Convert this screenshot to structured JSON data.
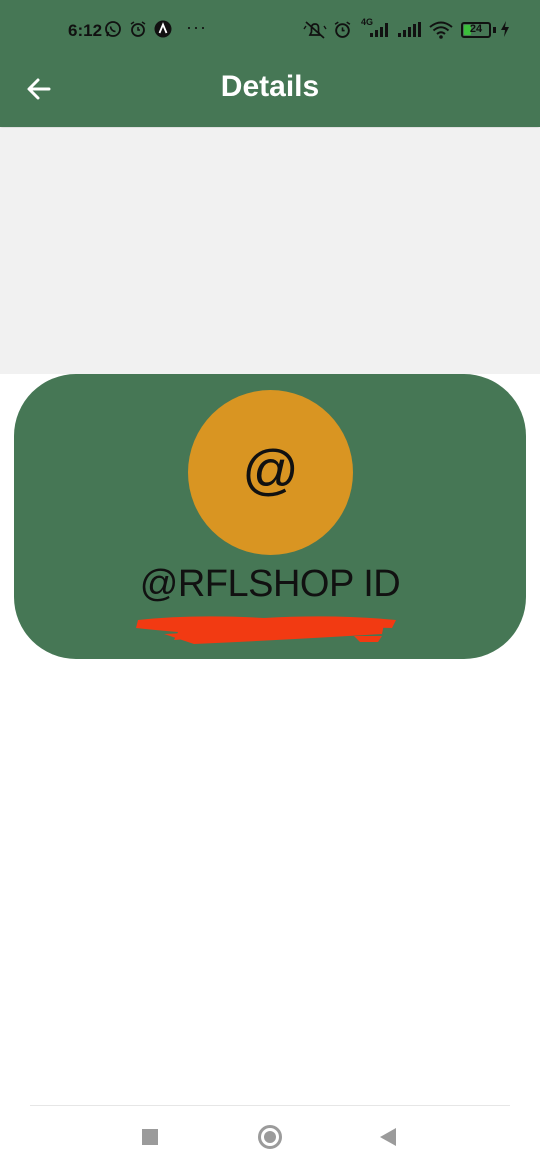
{
  "status_bar": {
    "time": "6:12",
    "icons": [
      "whatsapp-icon",
      "alarm-icon",
      "app-notification-icon",
      "more-notifications-icon",
      "mute-icon",
      "alarm-icon",
      "signal-4g-icon",
      "signal-icon",
      "wifi-icon",
      "battery-icon",
      "charging-icon"
    ],
    "more": "···",
    "network": "4G",
    "battery_level": "24"
  },
  "app_bar": {
    "title": "Details",
    "back_icon": "arrow-left-icon"
  },
  "card": {
    "avatar_symbol": "@",
    "title": "@RFLSHOP ID"
  },
  "nav_bar": {
    "buttons": [
      "recents-square-icon",
      "home-circle-icon",
      "back-triangle-icon"
    ]
  },
  "colors": {
    "primary": "#467755",
    "accent": "#d99522",
    "background_gray": "#f1f1f1",
    "redaction": "#f23a12"
  }
}
